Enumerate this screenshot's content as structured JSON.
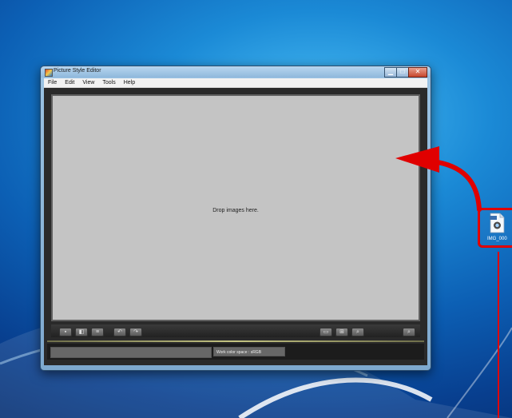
{
  "window": {
    "title": "Picture Style Editor",
    "menu": [
      "File",
      "Edit",
      "View",
      "Tools",
      "Help"
    ],
    "controls": {
      "minimize": "▁",
      "maximize": "□",
      "close": "✕"
    }
  },
  "viewer": {
    "drop_hint": "Drop images here."
  },
  "toolbar": {
    "left_buttons": [
      "view-mode-1",
      "view-mode-2",
      "view-mode-3",
      "rotate-left",
      "rotate-right"
    ],
    "right_buttons": [
      "fit",
      "grid",
      "zoom",
      "zoom-full"
    ]
  },
  "status": {
    "color_space": "Work color space : sRGB"
  },
  "desktop": {
    "file_label": "IMG_000"
  },
  "colors": {
    "highlight": "#e00000",
    "viewer_bg": "#c4c4c4",
    "window_bg": "#2a2a2a"
  }
}
